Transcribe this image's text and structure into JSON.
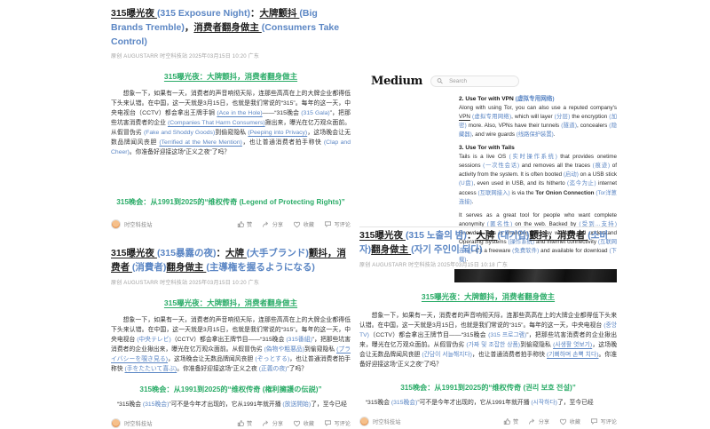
{
  "theme": {
    "green": "#2bac68",
    "blue": "#5b86c4",
    "text": "#303030",
    "meta": "#a3a3a3",
    "divider": "#e3e3e3"
  },
  "author": "时空科技站",
  "actions": {
    "like": "赞",
    "share": "分享",
    "favorite": "收藏",
    "comment": "写评论"
  },
  "panels": {
    "en": {
      "title": [
        {
          "t": "315曝光夜 ",
          "c": "ku"
        },
        {
          "t": "(315 Exposure Night)",
          "c": "b"
        },
        {
          "t": "：",
          "c": "k"
        },
        {
          "t": "大牌颤抖 ",
          "c": "ku"
        },
        {
          "t": "(Big Brands Tremble)",
          "c": "b"
        },
        {
          "t": "，",
          "c": "k"
        },
        {
          "t": "消费者翻身做主 ",
          "c": "ku"
        },
        {
          "t": "(Consumers Take Control)",
          "c": "b"
        }
      ],
      "meta": "原创 AUGUSTARR 时空科技站 2025年03月15日 10:20 广东",
      "section_heading": "315曝光夜：大牌颤抖，消费者翻身做主",
      "body": [
        {
          "t": "想象一下，如果有一天，消费者的声音响彻天际，连那些高高在上的大牌企业都得低下头来认错。在中国，这一天就是3月15日，也就是我们常说的“315”。每年的这一天，中央电视台（CCTV）都会拿出王牌手锏 ",
          "c": "k"
        },
        {
          "t": "(Ace in the Hole)",
          "c": "bu"
        },
        {
          "t": "——“315晚会 ",
          "c": "k"
        },
        {
          "t": "(315 Gala)",
          "c": "b"
        },
        {
          "t": "”，把那些坑害消费者的企业 ",
          "c": "k"
        },
        {
          "t": "(Companies That Harm Consumers)",
          "c": "bu"
        },
        {
          "t": "揪出来，曝光在亿万观众面前。从假冒伪劣 ",
          "c": "k"
        },
        {
          "t": "(Fake and Shoddy Goods)",
          "c": "b"
        },
        {
          "t": "到偷窥隐私 ",
          "c": "k"
        },
        {
          "t": "(Peeping into Privacy)",
          "c": "bu"
        },
        {
          "t": "，这场晚会让无数品牌闻风丧胆 ",
          "c": "k"
        },
        {
          "t": "(Terrified at the Mere Mention)",
          "c": "bu"
        },
        {
          "t": "，也让普通消费者拍手称快 ",
          "c": "k"
        },
        {
          "t": "(Clap and Cheer)",
          "c": "b"
        },
        {
          "t": "。你准备好迎接这场“正义之夜”了吗？",
          "c": "k"
        }
      ],
      "subheading": "315晚会：从1991到2025的“维权传奇 (Legend of Protecting Rights)”"
    },
    "ja": {
      "title": [
        {
          "t": "315曝光夜 ",
          "c": "ku"
        },
        {
          "t": "(315暴露の夜)",
          "c": "b"
        },
        {
          "t": "：",
          "c": "k"
        },
        {
          "t": "大牌 ",
          "c": "ku"
        },
        {
          "t": "(大手ブランド)",
          "c": "b"
        },
        {
          "t": "颤抖，消费者 ",
          "c": "ku"
        },
        {
          "t": "(消費者)",
          "c": "b"
        },
        {
          "t": "翻身做主 ",
          "c": "ku"
        },
        {
          "t": "(主導権を握るようになる)",
          "c": "b"
        }
      ],
      "meta": "原创 AUGUSTARR 时空科技站 2025年03月15日 10:20 广东",
      "section_heading": "315曝光夜：大牌颤抖，消费者翻身做主",
      "body": [
        {
          "t": "想象一下，如果有一天，消费者的声音响彻天际，连那些高高在上的大牌企业都得低下头来认错。在中国，这一天就是3月15日，也就是我们常说的“315”。每年的这一天，中央电视台 ",
          "c": "k"
        },
        {
          "t": "(中央テレビ)",
          "c": "b"
        },
        {
          "t": "（CCTV）都会拿出王牌节目——“315晚会 ",
          "c": "k"
        },
        {
          "t": "(315番組)",
          "c": "b"
        },
        {
          "t": "”，把那些坑害消费者的企业揪出来，曝光在亿万观众面前。从假冒伪劣 ",
          "c": "k"
        },
        {
          "t": "(偽物や粗悪品)",
          "c": "b"
        },
        {
          "t": "到偷窥隐私 ",
          "c": "k"
        },
        {
          "t": "(プライバシーを覗き見る)",
          "c": "bu"
        },
        {
          "t": "，这场晚会让无数品牌闻风丧胆 ",
          "c": "k"
        },
        {
          "t": "(ぞっとする)",
          "c": "b"
        },
        {
          "t": "，也让普通消费者拍手称快 ",
          "c": "k"
        },
        {
          "t": "(手をたたいて喜ぶ)",
          "c": "bu"
        },
        {
          "t": "。你准备好迎接这场“正义之夜 ",
          "c": "k"
        },
        {
          "t": "(正義の夜)",
          "c": "b"
        },
        {
          "t": "”了吗？",
          "c": "k"
        }
      ],
      "subheading": "315晚会：从1991到2025的“维权传奇 (権利擁護の伝説)”",
      "partial": [
        {
          "t": "“315晚会 ",
          "c": "k"
        },
        {
          "t": "(315晚会)",
          "c": "b"
        },
        {
          "t": "”可不是今年才出现的，它从1991年就开播 ",
          "c": "k"
        },
        {
          "t": "(放送開始)",
          "c": "b"
        },
        {
          "t": "了，至今已经",
          "c": "k"
        }
      ]
    },
    "ko": {
      "title": [
        {
          "t": "315曝光夜 ",
          "c": "ku"
        },
        {
          "t": "(315 노출의 밤)",
          "c": "b"
        },
        {
          "t": "：",
          "c": "k"
        },
        {
          "t": "大牌 ",
          "c": "ku"
        },
        {
          "t": "(대기업)",
          "c": "b"
        },
        {
          "t": "颤抖，消费者 ",
          "c": "ku"
        },
        {
          "t": "(소비자)",
          "c": "b"
        },
        {
          "t": "翻身做主 ",
          "c": "ku"
        },
        {
          "t": "(자기 주인이 되다)",
          "c": "b"
        }
      ],
      "meta": "原创 AUGUSTARR 时空科技站 2025年03月15日 10:18 广东",
      "section_heading": "315曝光夜：大牌颤抖，消费者翻身做主",
      "body": [
        {
          "t": "想象一下，如果有一天，消费者的声音响彻天际，连那些高高在上的大牌企业都得低下头来认错。在中国，这一天就是3月15日，也就是我们常说的“315”。每年的这一天，中央电视台 ",
          "c": "k"
        },
        {
          "t": "(중앙 TV)",
          "c": "b"
        },
        {
          "t": "（CCTV）都会拿出王牌节目——“315晚会 ",
          "c": "k"
        },
        {
          "t": "(315 프로그램)",
          "c": "b"
        },
        {
          "t": "”，把那些坑害消费者的企业揪出来，曝光在亿万观众面前。从假冒伪劣 ",
          "c": "k"
        },
        {
          "t": "(가짜 및 조잡한 상품)",
          "c": "b"
        },
        {
          "t": "到偷窥隐私 ",
          "c": "k"
        },
        {
          "t": "(사생활 엿보기)",
          "c": "bu"
        },
        {
          "t": "，这场晚会让无数品牌闻风丧胆 ",
          "c": "k"
        },
        {
          "t": "(간담이 서늘해지다)",
          "c": "b"
        },
        {
          "t": "，也让普通消费者拍手称快 ",
          "c": "k"
        },
        {
          "t": "(기뻐하며 손뼉 치다)",
          "c": "bu"
        },
        {
          "t": "。你准备好迎接这场“正义之夜”了吗？",
          "c": "k"
        }
      ],
      "subheading": "315晚会：从1991到2025的“维权传奇 (권리 보호 전설)”",
      "partial": [
        {
          "t": "“315晚会 ",
          "c": "k"
        },
        {
          "t": "(315晚会)",
          "c": "b"
        },
        {
          "t": "”可不是今年才出现的，它从1991年就开播 ",
          "c": "k"
        },
        {
          "t": "(시작하다)",
          "c": "b"
        },
        {
          "t": "了，至今已经",
          "c": "k"
        }
      ]
    }
  },
  "medium": {
    "logo": "Medium",
    "search_placeholder": "Search",
    "s1_heading": [
      {
        "t": "2. Use Tor with VPN ",
        "c": "hk"
      },
      {
        "t": "(虚拟专用网络)",
        "c": "b"
      }
    ],
    "s1_body": [
      {
        "t": "Along with using Tor, you can also use a reputed company's ",
        "c": "k"
      },
      {
        "t": "VPN",
        "c": "ku"
      },
      {
        "t": " ",
        "c": "k"
      },
      {
        "t": "(虚拟专用网络)",
        "c": "b"
      },
      {
        "t": ", which will layer ",
        "c": "k"
      },
      {
        "t": "(分层)",
        "c": "b"
      },
      {
        "t": " the encryption ",
        "c": "k"
      },
      {
        "t": "(加密)",
        "c": "b"
      },
      {
        "t": " more. Also, VPNs have their tunnels ",
        "c": "k"
      },
      {
        "t": "(隧道)",
        "c": "b"
      },
      {
        "t": ", concealers ",
        "c": "k"
      },
      {
        "t": "(隐藏器)",
        "c": "b"
      },
      {
        "t": ", and wire guards ",
        "c": "k"
      },
      {
        "t": "(线路保护装置)",
        "c": "b"
      },
      {
        "t": ".",
        "c": "k"
      }
    ],
    "s2_heading": [
      {
        "t": "3. Use Tor with Tails",
        "c": "hk"
      }
    ],
    "s2_body1": [
      {
        "t": "Tails is a live OS ",
        "c": "k"
      },
      {
        "t": "(实时操作系统)",
        "c": "b"
      },
      {
        "t": " that provides onetime sessions ",
        "c": "k"
      },
      {
        "t": "(一次性会话)",
        "c": "b"
      },
      {
        "t": " and removes all the traces ",
        "c": "k"
      },
      {
        "t": "(痕迹)",
        "c": "b"
      },
      {
        "t": " of activity from the system. It is often booted ",
        "c": "k"
      },
      {
        "t": "(启动)",
        "c": "b"
      },
      {
        "t": " on a USB stick ",
        "c": "k"
      },
      {
        "t": "(U盘)",
        "c": "b"
      },
      {
        "t": ", even used in USB, and its hitherto ",
        "c": "k"
      },
      {
        "t": "(迄今为止)",
        "c": "b"
      },
      {
        "t": " internet access ",
        "c": "k"
      },
      {
        "t": "(互联网接入)",
        "c": "b"
      },
      {
        "t": " is via the ",
        "c": "k"
      },
      {
        "t": "Tor Onion Connection",
        "c": "kb"
      },
      {
        "t": " ",
        "c": "k"
      },
      {
        "t": "(Tor洋葱连接)",
        "c": "b"
      },
      {
        "t": ".",
        "c": "k"
      }
    ],
    "s2_body2": [
      {
        "t": "It serves as a great tool for people who want complete anonymity ",
        "c": "k"
      },
      {
        "t": "(匿名性)",
        "c": "b"
      },
      {
        "t": " on the web. Backed by ",
        "c": "k"
      },
      {
        "t": "(受到...支持)",
        "c": "b"
      },
      {
        "t": " Snowden Tails is changing the way we see and understand Operating Systems ",
        "c": "k"
      },
      {
        "t": "(操作系统)",
        "c": "b"
      },
      {
        "t": " and internet connectivity ",
        "c": "k"
      },
      {
        "t": "(互联网连接)",
        "c": "b"
      },
      {
        "t": ". It's a freeware ",
        "c": "k"
      },
      {
        "t": "(免费软件)",
        "c": "b"
      },
      {
        "t": " and available for download ",
        "c": "k"
      },
      {
        "t": "(下载)",
        "c": "b"
      },
      {
        "t": ".",
        "c": "k"
      }
    ]
  }
}
